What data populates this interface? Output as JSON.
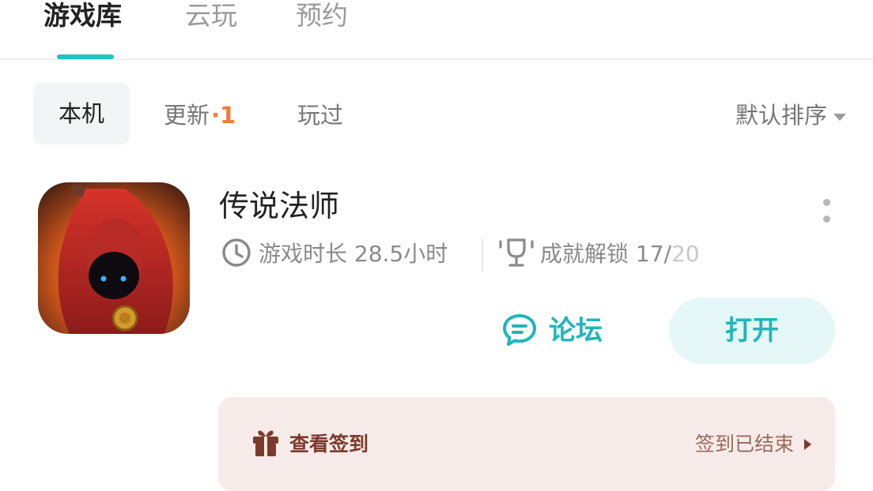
{
  "top_tabs": [
    {
      "label": "游戏库",
      "active": true
    },
    {
      "label": "云玩",
      "active": false
    },
    {
      "label": "预约",
      "active": false
    }
  ],
  "filters": {
    "local": "本机",
    "update": "更新",
    "update_badge": "·1",
    "played": "玩过",
    "sort": "默认排序"
  },
  "game": {
    "title": "传说法师",
    "playtime_label": "游戏时长",
    "playtime_value": "28.5小时",
    "achievement_label": "成就解锁",
    "achievement_unlocked": "17/",
    "achievement_total": "20",
    "forum_label": "论坛",
    "open_label": "打开"
  },
  "signin": {
    "label": "查看签到",
    "status": "签到已结束"
  },
  "colors": {
    "accent": "#1fc2c7",
    "badge": "#f07a3c",
    "signin_bg": "#f6ebe8",
    "signin_text": "#7a3a2c"
  },
  "icons": {
    "clock": "clock-icon",
    "trophy": "trophy-icon",
    "forum": "chat-bubble-icon",
    "gift": "gift-icon",
    "more": "more-vertical-icon",
    "sort_caret": "caret-down-icon",
    "signin_arrow": "chevron-right-icon"
  }
}
